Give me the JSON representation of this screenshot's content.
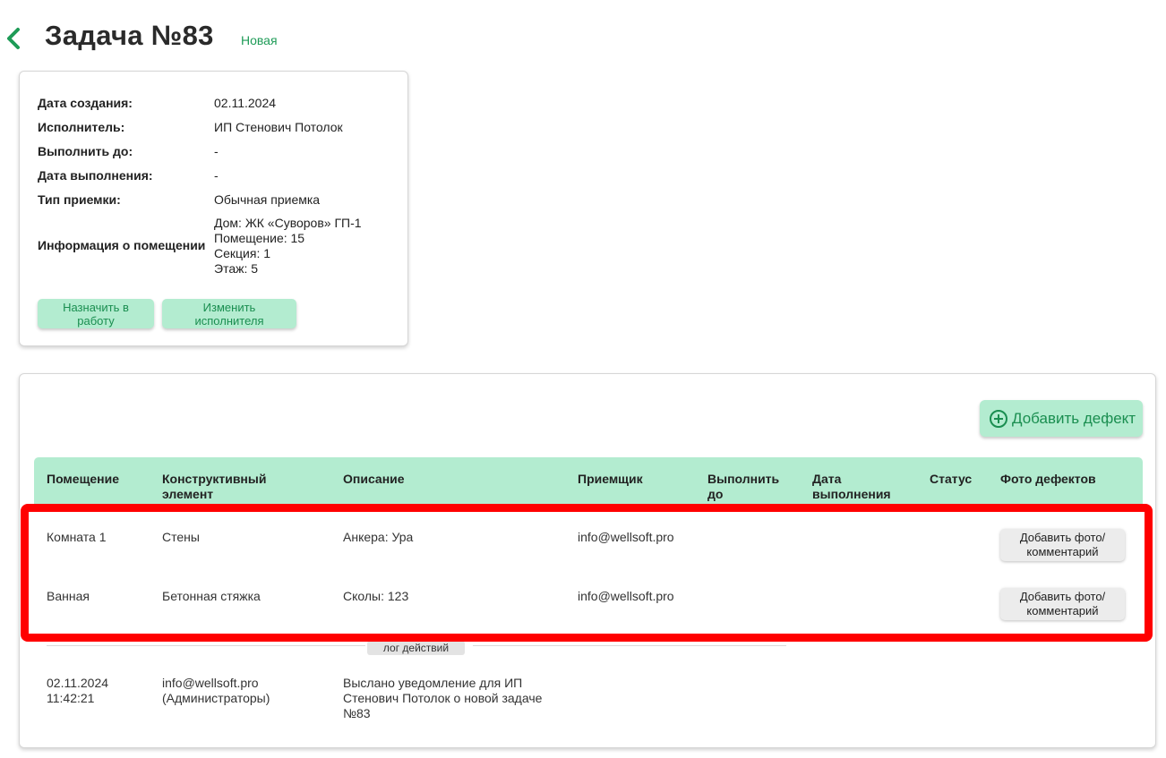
{
  "header": {
    "title": "Задача №83",
    "status": "Новая"
  },
  "info": {
    "rows": [
      {
        "label": "Дата создания:",
        "value": "02.11.2024"
      },
      {
        "label": "Исполнитель:",
        "value": "ИП Стенович Потолок"
      },
      {
        "label": "Выполнить до:",
        "value": "-"
      },
      {
        "label": "Дата выполнения:",
        "value": "-"
      },
      {
        "label": "Тип приемки:",
        "value": "Обычная приемка"
      }
    ],
    "room_label": "Информация о помещении",
    "room_lines": [
      "Дом: ЖК «Суворов» ГП-1",
      "Помещение: 15",
      "Секция: 1",
      "Этаж: 5"
    ],
    "assign_button": "Назначить в работу",
    "change_button": "Изменить исполнителя"
  },
  "defects": {
    "add_button": "Добавить дефект",
    "columns": [
      "Помещение",
      "Конструктивный элемент",
      "Описание",
      "Приемщик",
      "Выполнить до",
      "Дата выполнения",
      "Статус",
      "Фото дефектов"
    ],
    "rows": [
      {
        "room": "Комната 1",
        "element": "Стены",
        "description": "Анкера: Ура",
        "inspector": "info@wellsoft.pro",
        "due": "",
        "done": "",
        "status": "",
        "photo_button": "Добавить фото/ комментарий"
      },
      {
        "room": "Ванная",
        "element": "Бетонная стяжка",
        "description": "Сколы: 123",
        "inspector": "info@wellsoft.pro",
        "due": "",
        "done": "",
        "status": "",
        "photo_button": "Добавить фото/ комментарий"
      }
    ]
  },
  "log": {
    "tag": "лог действий",
    "entries": [
      {
        "datetime": "02.11.2024 11:42:21",
        "user": "info@wellsoft.pro (Администраторы)",
        "message": "Выслано уведомление для ИП Стенович Потолок о новой задаче №83"
      }
    ]
  },
  "colors": {
    "accent": "#1e9b57",
    "button_bg": "#b3ecd0",
    "highlight": "#ff0000"
  }
}
